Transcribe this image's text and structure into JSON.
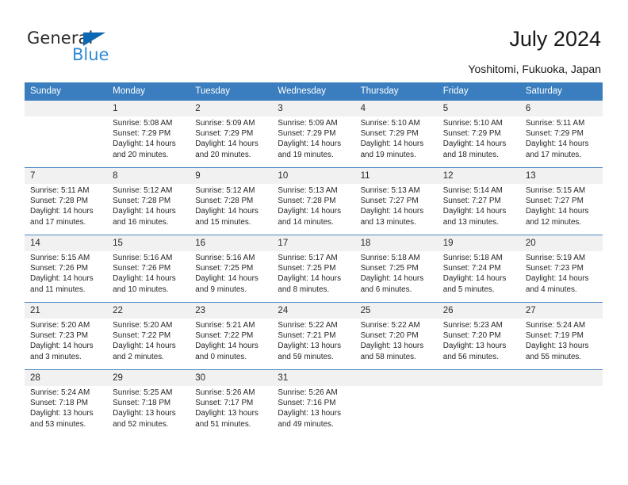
{
  "brand": {
    "name_part1": "General",
    "name_part2": "Blue",
    "color_dark": "#2b2b2b",
    "color_blue": "#2e8ad4",
    "triangle_color": "#0b69b4"
  },
  "header": {
    "title": "July 2024",
    "subtitle": "Yoshitomi, Fukuoka, Japan"
  },
  "theme": {
    "header_bg": "#3a7ebf",
    "daynum_bg": "#f1f1f1",
    "separator": "#4a87c4",
    "cell_bg": "#ffffff"
  },
  "weekdays": [
    "Sunday",
    "Monday",
    "Tuesday",
    "Wednesday",
    "Thursday",
    "Friday",
    "Saturday"
  ],
  "weeks": [
    [
      {
        "day": "",
        "sunrise": "",
        "sunset": "",
        "daylight1": "",
        "daylight2": ""
      },
      {
        "day": "1",
        "sunrise": "Sunrise: 5:08 AM",
        "sunset": "Sunset: 7:29 PM",
        "daylight1": "Daylight: 14 hours",
        "daylight2": "and 20 minutes."
      },
      {
        "day": "2",
        "sunrise": "Sunrise: 5:09 AM",
        "sunset": "Sunset: 7:29 PM",
        "daylight1": "Daylight: 14 hours",
        "daylight2": "and 20 minutes."
      },
      {
        "day": "3",
        "sunrise": "Sunrise: 5:09 AM",
        "sunset": "Sunset: 7:29 PM",
        "daylight1": "Daylight: 14 hours",
        "daylight2": "and 19 minutes."
      },
      {
        "day": "4",
        "sunrise": "Sunrise: 5:10 AM",
        "sunset": "Sunset: 7:29 PM",
        "daylight1": "Daylight: 14 hours",
        "daylight2": "and 19 minutes."
      },
      {
        "day": "5",
        "sunrise": "Sunrise: 5:10 AM",
        "sunset": "Sunset: 7:29 PM",
        "daylight1": "Daylight: 14 hours",
        "daylight2": "and 18 minutes."
      },
      {
        "day": "6",
        "sunrise": "Sunrise: 5:11 AM",
        "sunset": "Sunset: 7:29 PM",
        "daylight1": "Daylight: 14 hours",
        "daylight2": "and 17 minutes."
      }
    ],
    [
      {
        "day": "7",
        "sunrise": "Sunrise: 5:11 AM",
        "sunset": "Sunset: 7:28 PM",
        "daylight1": "Daylight: 14 hours",
        "daylight2": "and 17 minutes."
      },
      {
        "day": "8",
        "sunrise": "Sunrise: 5:12 AM",
        "sunset": "Sunset: 7:28 PM",
        "daylight1": "Daylight: 14 hours",
        "daylight2": "and 16 minutes."
      },
      {
        "day": "9",
        "sunrise": "Sunrise: 5:12 AM",
        "sunset": "Sunset: 7:28 PM",
        "daylight1": "Daylight: 14 hours",
        "daylight2": "and 15 minutes."
      },
      {
        "day": "10",
        "sunrise": "Sunrise: 5:13 AM",
        "sunset": "Sunset: 7:28 PM",
        "daylight1": "Daylight: 14 hours",
        "daylight2": "and 14 minutes."
      },
      {
        "day": "11",
        "sunrise": "Sunrise: 5:13 AM",
        "sunset": "Sunset: 7:27 PM",
        "daylight1": "Daylight: 14 hours",
        "daylight2": "and 13 minutes."
      },
      {
        "day": "12",
        "sunrise": "Sunrise: 5:14 AM",
        "sunset": "Sunset: 7:27 PM",
        "daylight1": "Daylight: 14 hours",
        "daylight2": "and 13 minutes."
      },
      {
        "day": "13",
        "sunrise": "Sunrise: 5:15 AM",
        "sunset": "Sunset: 7:27 PM",
        "daylight1": "Daylight: 14 hours",
        "daylight2": "and 12 minutes."
      }
    ],
    [
      {
        "day": "14",
        "sunrise": "Sunrise: 5:15 AM",
        "sunset": "Sunset: 7:26 PM",
        "daylight1": "Daylight: 14 hours",
        "daylight2": "and 11 minutes."
      },
      {
        "day": "15",
        "sunrise": "Sunrise: 5:16 AM",
        "sunset": "Sunset: 7:26 PM",
        "daylight1": "Daylight: 14 hours",
        "daylight2": "and 10 minutes."
      },
      {
        "day": "16",
        "sunrise": "Sunrise: 5:16 AM",
        "sunset": "Sunset: 7:25 PM",
        "daylight1": "Daylight: 14 hours",
        "daylight2": "and 9 minutes."
      },
      {
        "day": "17",
        "sunrise": "Sunrise: 5:17 AM",
        "sunset": "Sunset: 7:25 PM",
        "daylight1": "Daylight: 14 hours",
        "daylight2": "and 8 minutes."
      },
      {
        "day": "18",
        "sunrise": "Sunrise: 5:18 AM",
        "sunset": "Sunset: 7:25 PM",
        "daylight1": "Daylight: 14 hours",
        "daylight2": "and 6 minutes."
      },
      {
        "day": "19",
        "sunrise": "Sunrise: 5:18 AM",
        "sunset": "Sunset: 7:24 PM",
        "daylight1": "Daylight: 14 hours",
        "daylight2": "and 5 minutes."
      },
      {
        "day": "20",
        "sunrise": "Sunrise: 5:19 AM",
        "sunset": "Sunset: 7:23 PM",
        "daylight1": "Daylight: 14 hours",
        "daylight2": "and 4 minutes."
      }
    ],
    [
      {
        "day": "21",
        "sunrise": "Sunrise: 5:20 AM",
        "sunset": "Sunset: 7:23 PM",
        "daylight1": "Daylight: 14 hours",
        "daylight2": "and 3 minutes."
      },
      {
        "day": "22",
        "sunrise": "Sunrise: 5:20 AM",
        "sunset": "Sunset: 7:22 PM",
        "daylight1": "Daylight: 14 hours",
        "daylight2": "and 2 minutes."
      },
      {
        "day": "23",
        "sunrise": "Sunrise: 5:21 AM",
        "sunset": "Sunset: 7:22 PM",
        "daylight1": "Daylight: 14 hours",
        "daylight2": "and 0 minutes."
      },
      {
        "day": "24",
        "sunrise": "Sunrise: 5:22 AM",
        "sunset": "Sunset: 7:21 PM",
        "daylight1": "Daylight: 13 hours",
        "daylight2": "and 59 minutes."
      },
      {
        "day": "25",
        "sunrise": "Sunrise: 5:22 AM",
        "sunset": "Sunset: 7:20 PM",
        "daylight1": "Daylight: 13 hours",
        "daylight2": "and 58 minutes."
      },
      {
        "day": "26",
        "sunrise": "Sunrise: 5:23 AM",
        "sunset": "Sunset: 7:20 PM",
        "daylight1": "Daylight: 13 hours",
        "daylight2": "and 56 minutes."
      },
      {
        "day": "27",
        "sunrise": "Sunrise: 5:24 AM",
        "sunset": "Sunset: 7:19 PM",
        "daylight1": "Daylight: 13 hours",
        "daylight2": "and 55 minutes."
      }
    ],
    [
      {
        "day": "28",
        "sunrise": "Sunrise: 5:24 AM",
        "sunset": "Sunset: 7:18 PM",
        "daylight1": "Daylight: 13 hours",
        "daylight2": "and 53 minutes."
      },
      {
        "day": "29",
        "sunrise": "Sunrise: 5:25 AM",
        "sunset": "Sunset: 7:18 PM",
        "daylight1": "Daylight: 13 hours",
        "daylight2": "and 52 minutes."
      },
      {
        "day": "30",
        "sunrise": "Sunrise: 5:26 AM",
        "sunset": "Sunset: 7:17 PM",
        "daylight1": "Daylight: 13 hours",
        "daylight2": "and 51 minutes."
      },
      {
        "day": "31",
        "sunrise": "Sunrise: 5:26 AM",
        "sunset": "Sunset: 7:16 PM",
        "daylight1": "Daylight: 13 hours",
        "daylight2": "and 49 minutes."
      },
      {
        "day": "",
        "sunrise": "",
        "sunset": "",
        "daylight1": "",
        "daylight2": ""
      },
      {
        "day": "",
        "sunrise": "",
        "sunset": "",
        "daylight1": "",
        "daylight2": ""
      },
      {
        "day": "",
        "sunrise": "",
        "sunset": "",
        "daylight1": "",
        "daylight2": ""
      }
    ]
  ]
}
